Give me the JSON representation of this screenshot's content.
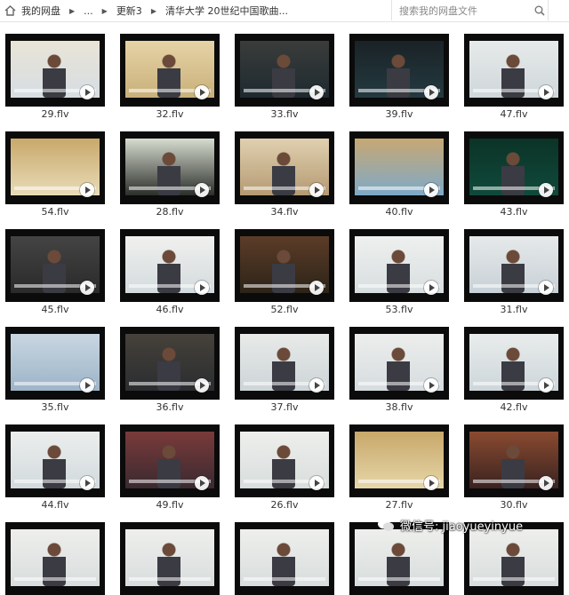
{
  "breadcrumb": {
    "items": [
      "我的网盘",
      "...",
      "更新3",
      "清华大学 20世纪中国歌曲..."
    ]
  },
  "search": {
    "placeholder": "搜索我的网盘文件"
  },
  "files": [
    {
      "name": "29.flv"
    },
    {
      "name": "32.flv"
    },
    {
      "name": "33.flv"
    },
    {
      "name": "39.flv"
    },
    {
      "name": "47.flv"
    },
    {
      "name": "54.flv"
    },
    {
      "name": "28.flv"
    },
    {
      "name": "34.flv"
    },
    {
      "name": "40.flv"
    },
    {
      "name": "43.flv"
    },
    {
      "name": "45.flv"
    },
    {
      "name": "46.flv"
    },
    {
      "name": "52.flv"
    },
    {
      "name": "53.flv"
    },
    {
      "name": "31.flv"
    },
    {
      "name": "35.flv"
    },
    {
      "name": "36.flv"
    },
    {
      "name": "37.flv"
    },
    {
      "name": "38.flv"
    },
    {
      "name": "42.flv"
    },
    {
      "name": "44.flv"
    },
    {
      "name": "49.flv"
    },
    {
      "name": "26.flv"
    },
    {
      "name": "27.flv"
    },
    {
      "name": "30.flv"
    },
    {
      "name": ""
    },
    {
      "name": ""
    },
    {
      "name": ""
    },
    {
      "name": ""
    },
    {
      "name": ""
    }
  ],
  "watermark": {
    "text": "微信号: jiaoyueyinyue"
  },
  "colors": {
    "thumb_frame": "#0b0b0b",
    "play_button": "#ffffff"
  }
}
